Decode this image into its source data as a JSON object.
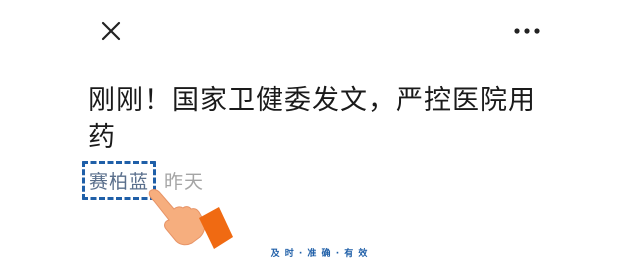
{
  "header": {
    "close_icon": "close-icon",
    "more_icon": "more-options-icon"
  },
  "article": {
    "title": "刚刚！国家卫健委发文，严控医院用药",
    "author": "赛柏蓝",
    "date": "昨天"
  },
  "overlay": {
    "pointer_icon": "hand-pointer-icon",
    "highlight_color": "#1f5fa8",
    "hand_color": "#f6ae7e",
    "cuff_color": "#f06a12"
  },
  "footer": {
    "slogan": "及 时 · 准 确 · 有 效"
  }
}
